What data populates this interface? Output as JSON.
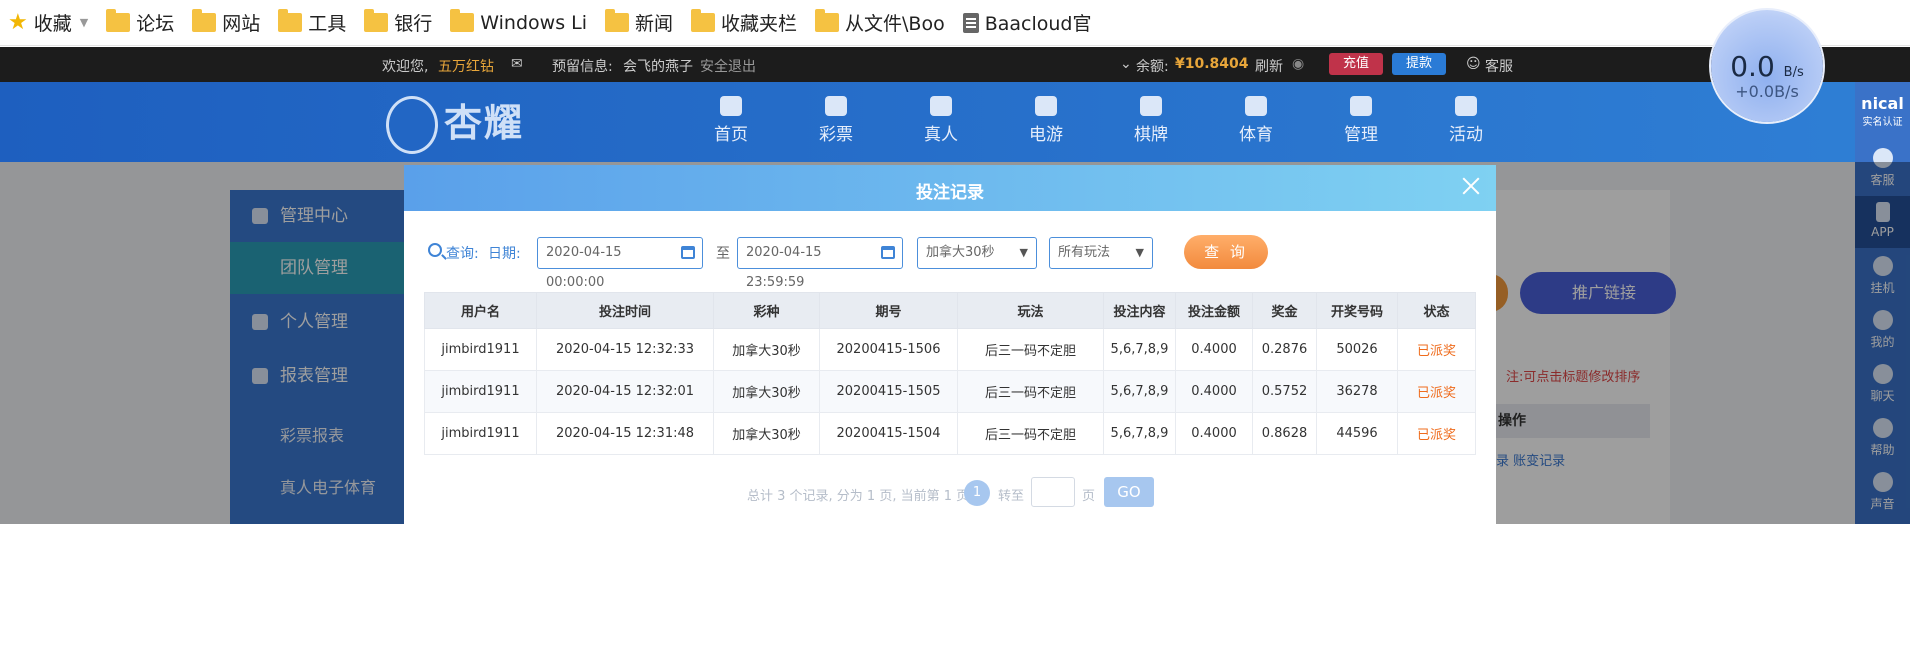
{
  "bookmarks": {
    "favorites": "收藏",
    "items": [
      "论坛",
      "网站",
      "工具",
      "银行",
      "Windows Li",
      "新闻",
      "收藏夹栏",
      "从文件\\Boo"
    ],
    "last": "Baacloud官"
  },
  "speed": {
    "main": "0.0",
    "unit": "B/s",
    "sub": "+0.0B/s"
  },
  "topbar": {
    "welcome": "欢迎您,",
    "username": "五万红钻",
    "reserved_label": "预留信息:",
    "reserved_value": "会飞的燕子",
    "logout": "安全退出",
    "balance_label": "余额:",
    "balance": "¥10.8404",
    "refresh": "刷新",
    "charge": "充值",
    "withdraw": "提款",
    "service": "客服"
  },
  "site": {
    "logo": "杏耀",
    "nav": [
      "首页",
      "彩票",
      "真人",
      "电游",
      "棋牌",
      "体育",
      "管理",
      "活动"
    ]
  },
  "sidebar": {
    "management_center": "管理中心",
    "team_management": "团队管理",
    "personal_management": "个人管理",
    "report_management": "报表管理",
    "lottery_report": "彩票报表",
    "live_sports": "真人电子体育"
  },
  "background": {
    "promo_link": "推广链接",
    "note": "注:可点击标题修改排序",
    "op_header": "操作",
    "op_links": "录  账变记录"
  },
  "right_tools": [
    "nical",
    "客服",
    "APP",
    "挂机",
    "我的",
    "聊天",
    "帮助",
    "声音"
  ],
  "right_tools_sub": "实名认证",
  "modal": {
    "title": "投注记录",
    "query_label": "查询:",
    "date_label": "日期:",
    "date_from": "2020-04-15 00:00:00",
    "to_label": "至",
    "date_to": "2020-04-15 23:59:59",
    "lottery_select": "加拿大30秒",
    "play_select": "所有玩法",
    "query_button": "查 询",
    "columns": [
      "用户名",
      "投注时间",
      "彩种",
      "期号",
      "玩法",
      "投注内容",
      "投注金额",
      "奖金",
      "开奖号码",
      "状态"
    ],
    "rows": [
      [
        "jimbird1911",
        "2020-04-15 12:32:33",
        "加拿大30秒",
        "20200415-1506",
        "后三一码不定胆",
        "5,6,7,8,9",
        "0.4000",
        "0.2876",
        "50026",
        "已派奖"
      ],
      [
        "jimbird1911",
        "2020-04-15 12:32:01",
        "加拿大30秒",
        "20200415-1505",
        "后三一码不定胆",
        "5,6,7,8,9",
        "0.4000",
        "0.5752",
        "36278",
        "已派奖"
      ],
      [
        "jimbird1911",
        "2020-04-15 12:31:48",
        "加拿大30秒",
        "20200415-1504",
        "后三一码不定胆",
        "5,6,7,8,9",
        "0.4000",
        "0.8628",
        "44596",
        "已派奖"
      ]
    ],
    "pager": {
      "summary": "总计 3 个记录, 分为 1 页, 当前第 1 页",
      "current": "1",
      "goto_label": "转至",
      "page_unit": "页",
      "go": "GO"
    }
  }
}
